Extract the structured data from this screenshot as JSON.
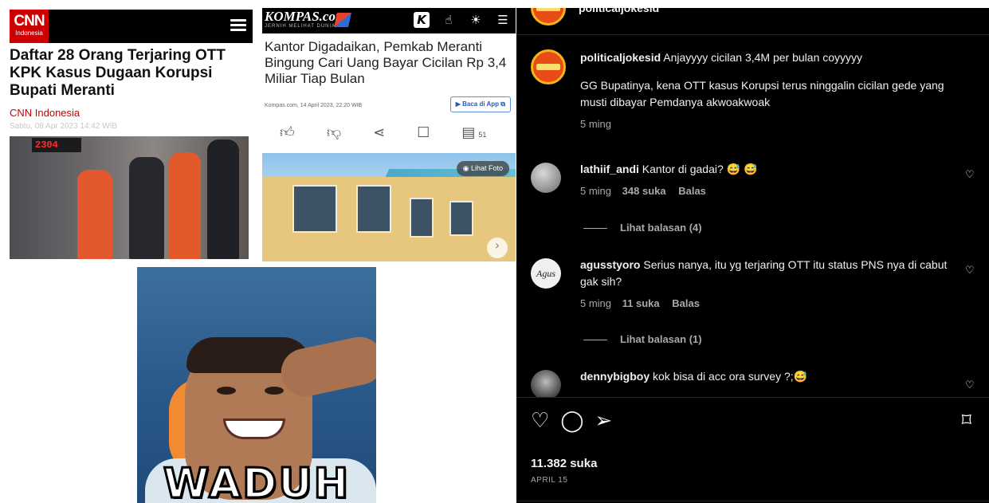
{
  "cnn": {
    "logo_text": "CNN",
    "logo_sub": "Indonesia",
    "headline": "Daftar 28 Orang Terjaring OTT KPK Kasus Dugaan Korupsi Bupati Meranti",
    "source": "CNN Indonesia",
    "date": "Sabtu, 08 Apr 2023 14:42 WIB",
    "photo_clock": "2304"
  },
  "kompas": {
    "logo": "KOMPAS.com",
    "tagline": "JERNIH MELIHAT DUNIA",
    "headline": "Kantor Digadaikan, Pemkab Meranti Bingung Cari Uang Bayar Cicilan Rp 3,4 Miliar Tiap Bulan",
    "meta_date": "Kompas.com, 14 April 2023, 22:20 WIB",
    "app_button": "Baca di App",
    "comment_count": "51",
    "photo_button": "Lihat Foto"
  },
  "meme": {
    "caption": "WADUH"
  },
  "instagram": {
    "header_username": "politicaljokesid",
    "comments": [
      {
        "username": "politicaljokesid",
        "text": "Anjayyyy cicilan 3,4M per bulan coyyyyy",
        "text2": "GG Bupatinya, kena OTT kasus Korupsi terus ninggalin cicilan gede yang musti dibayar Pemdanya akwoakwoak",
        "time": "5 ming"
      },
      {
        "username": "lathiif_andi",
        "text": "Kantor di gadai? 😅 😅",
        "time": "5 ming",
        "likes": "348 suka",
        "reply": "Balas",
        "view_replies": "Lihat balasan (4)"
      },
      {
        "username": "agusstyoro",
        "text": "Serius nanya, itu yg terjaring OTT itu status PNS nya di cabut gak sih?",
        "time": "5 ming",
        "likes": "11 suka",
        "reply": "Balas",
        "view_replies": "Lihat balasan (1)"
      },
      {
        "username": "dennybigboy",
        "text": "kok bisa di acc ora survey ?;😅"
      }
    ],
    "likes_total": "11.382 suka",
    "post_date": "APRIL 15",
    "icons": [
      "heart-icon",
      "comment-icon",
      "share-icon",
      "bookmark-icon"
    ]
  },
  "colors": {
    "cnn_red": "#cc0000",
    "ig_background": "#000000",
    "ig_secondary_text": "#a8a8a8"
  }
}
